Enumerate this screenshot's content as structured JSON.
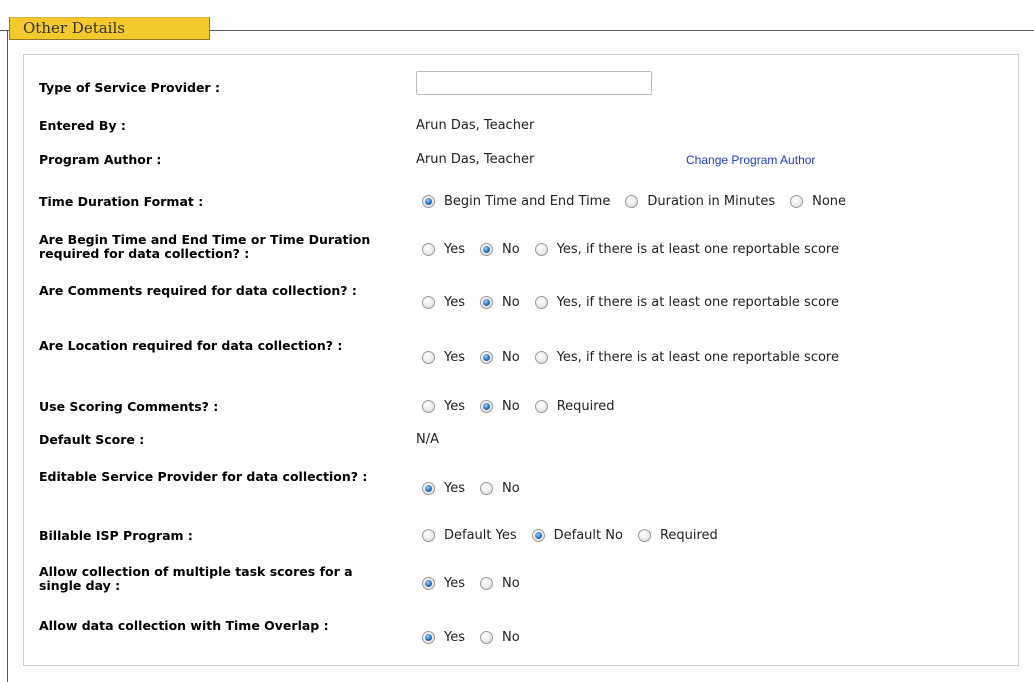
{
  "section": {
    "title": "Other Details"
  },
  "rows": [
    {
      "label": "Type of Service Provider :",
      "input_value": ""
    },
    {
      "label": "Entered By :",
      "value": "Arun Das, Teacher"
    },
    {
      "label": "Program Author :",
      "value": "Arun Das, Teacher",
      "link": "Change Program Author"
    },
    {
      "label": "Time Duration Format :",
      "options": [
        {
          "label": "Begin Time and End Time",
          "checked": true
        },
        {
          "label": "Duration in Minutes",
          "checked": false
        },
        {
          "label": "None",
          "checked": false
        }
      ]
    },
    {
      "label": "Are Begin Time and End Time or Time Duration required for data collection? :",
      "options": [
        {
          "label": "Yes",
          "checked": false
        },
        {
          "label": "No",
          "checked": true
        },
        {
          "label": "Yes, if there is at least one reportable score",
          "checked": false
        }
      ]
    },
    {
      "label": "Are Comments required for data collection? :",
      "options": [
        {
          "label": "Yes",
          "checked": false
        },
        {
          "label": "No",
          "checked": true
        },
        {
          "label": "Yes, if there is at least one reportable score",
          "checked": false
        }
      ]
    },
    {
      "label": "Are Location required for data collection? :",
      "options": [
        {
          "label": "Yes",
          "checked": false
        },
        {
          "label": "No",
          "checked": true
        },
        {
          "label": "Yes, if there is at least one reportable score",
          "checked": false
        }
      ]
    },
    {
      "label": "Use Scoring Comments? :",
      "options": [
        {
          "label": "Yes",
          "checked": false
        },
        {
          "label": "No",
          "checked": true
        },
        {
          "label": "Required",
          "checked": false
        }
      ]
    },
    {
      "label": "Default Score :",
      "value": "N/A"
    },
    {
      "label": "Editable Service Provider for data collection? :",
      "options": [
        {
          "label": "Yes",
          "checked": true
        },
        {
          "label": "No",
          "checked": false
        }
      ]
    },
    {
      "label": "Billable ISP Program :",
      "options": [
        {
          "label": "Default Yes",
          "checked": false
        },
        {
          "label": "Default No",
          "checked": true
        },
        {
          "label": "Required",
          "checked": false
        }
      ]
    },
    {
      "label": "Allow collection of multiple task scores for a single day :",
      "options": [
        {
          "label": "Yes",
          "checked": true
        },
        {
          "label": "No",
          "checked": false
        }
      ]
    },
    {
      "label": "Allow data collection with Time Overlap :",
      "options": [
        {
          "label": "Yes",
          "checked": true
        },
        {
          "label": "No",
          "checked": false
        }
      ]
    }
  ]
}
